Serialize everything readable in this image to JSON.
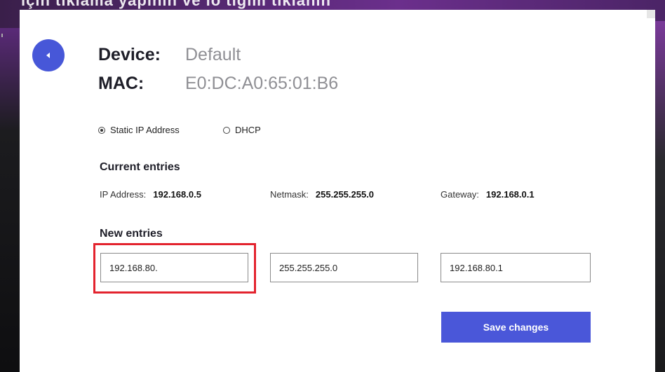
{
  "background": {
    "top_text": "ıçın tıklama yapının  ve  ıo tığım tıklanın"
  },
  "device": {
    "label": "Device:",
    "value": "Default"
  },
  "mac": {
    "label": "MAC:",
    "value": "E0:DC:A0:65:01:B6"
  },
  "mode": {
    "options": [
      {
        "label": "Static IP Address",
        "selected": true
      },
      {
        "label": "DHCP",
        "selected": false
      }
    ]
  },
  "current": {
    "title": "Current entries",
    "ip_label": "IP Address:",
    "ip_value": "192.168.0.5",
    "netmask_label": "Netmask:",
    "netmask_value": "255.255.255.0",
    "gateway_label": "Gateway:",
    "gateway_value": "192.168.0.1"
  },
  "new_entries": {
    "title": "New entries",
    "ip": "192.168.80.",
    "netmask": "255.255.255.0",
    "gateway": "192.168.80.1"
  },
  "actions": {
    "save_label": "Save changes"
  },
  "colors": {
    "accent": "#4a57d9",
    "highlight": "#e3232e"
  }
}
